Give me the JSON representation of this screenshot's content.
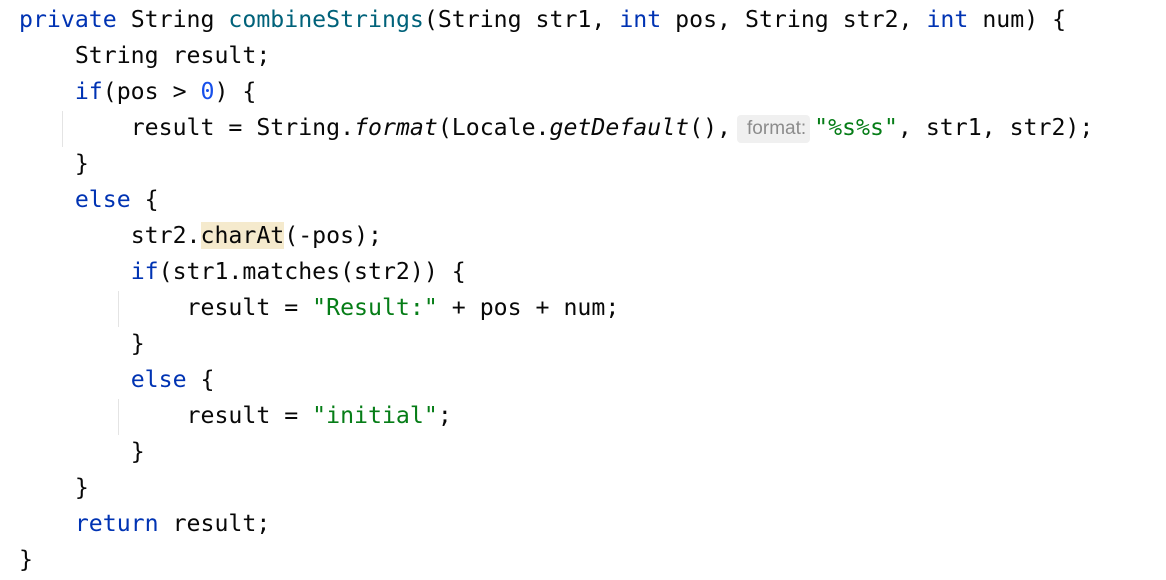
{
  "editor": {
    "language": "Java",
    "colors": {
      "keyword": "#0033b3",
      "method_declaration": "#00627a",
      "string": "#067d17",
      "number": "#1750eb",
      "text": "#080808",
      "inlay_hint": "#8c8c8c",
      "usage_highlight": "#f5eacd"
    },
    "lines": [
      {
        "indent": "",
        "tokens": [
          {
            "t": "private",
            "c": "kw"
          },
          {
            "t": " String "
          },
          {
            "t": "combineStrings",
            "c": "fn"
          },
          {
            "t": "(String str1, "
          },
          {
            "t": "int",
            "c": "kw"
          },
          {
            "t": " pos, String str2, "
          },
          {
            "t": "int",
            "c": "kw"
          },
          {
            "t": " num) {"
          }
        ]
      },
      {
        "indent": "    ",
        "tokens": [
          {
            "t": "String result;"
          }
        ]
      },
      {
        "indent": "    ",
        "tokens": [
          {
            "t": "if",
            "c": "kw"
          },
          {
            "t": "(pos > "
          },
          {
            "t": "0",
            "c": "num"
          },
          {
            "t": ") {"
          }
        ]
      },
      {
        "indent": "        ",
        "tokens": [
          {
            "t": "result = String."
          },
          {
            "t": "format",
            "c": "it"
          },
          {
            "t": "(Locale."
          },
          {
            "t": "getDefault",
            "c": "it"
          },
          {
            "t": "(),"
          },
          {
            "hint": "format:"
          },
          {
            "t": "\"%s%s\"",
            "c": "str"
          },
          {
            "t": ", str1, str2);"
          }
        ]
      },
      {
        "indent": "    ",
        "tokens": [
          {
            "t": "}"
          }
        ]
      },
      {
        "indent": "    ",
        "tokens": [
          {
            "t": "else",
            "c": "kw"
          },
          {
            "t": " {"
          }
        ]
      },
      {
        "indent": "        ",
        "tokens": [
          {
            "t": "str2."
          },
          {
            "t": "charAt",
            "c": "hl"
          },
          {
            "t": "(-pos);"
          }
        ]
      },
      {
        "indent": "        ",
        "tokens": [
          {
            "t": "if",
            "c": "kw"
          },
          {
            "t": "(str1.matches(str2)) {"
          }
        ]
      },
      {
        "indent": "            ",
        "tokens": [
          {
            "t": "result = "
          },
          {
            "t": "\"Result:\"",
            "c": "str"
          },
          {
            "t": " + pos + num;"
          }
        ]
      },
      {
        "indent": "        ",
        "tokens": [
          {
            "t": "}"
          }
        ]
      },
      {
        "indent": "        ",
        "tokens": [
          {
            "t": "else",
            "c": "kw"
          },
          {
            "t": " {"
          }
        ]
      },
      {
        "indent": "            ",
        "tokens": [
          {
            "t": "result = "
          },
          {
            "t": "\"initial\"",
            "c": "str"
          },
          {
            "t": ";"
          }
        ]
      },
      {
        "indent": "        ",
        "tokens": [
          {
            "t": "}"
          }
        ]
      },
      {
        "indent": "    ",
        "tokens": [
          {
            "t": "}"
          }
        ]
      },
      {
        "indent": "    ",
        "tokens": [
          {
            "t": "return",
            "c": "kw"
          },
          {
            "t": " result;"
          }
        ]
      },
      {
        "indent": "",
        "tokens": [
          {
            "t": "}"
          }
        ]
      }
    ]
  }
}
